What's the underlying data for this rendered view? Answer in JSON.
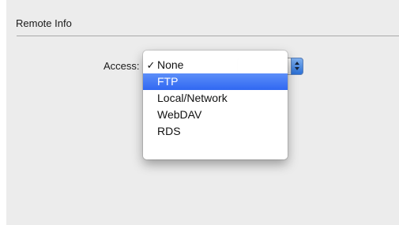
{
  "section": {
    "title": "Remote Info"
  },
  "access": {
    "label": "Access:",
    "selected": "None",
    "options": [
      {
        "label": "None",
        "checked": true,
        "highlighted": false
      },
      {
        "label": "FTP",
        "checked": false,
        "highlighted": true
      },
      {
        "label": "Local/Network",
        "checked": false,
        "highlighted": false
      },
      {
        "label": "WebDAV",
        "checked": false,
        "highlighted": false
      },
      {
        "label": "RDS",
        "checked": false,
        "highlighted": false
      }
    ],
    "check_glyph": "✓"
  },
  "colors": {
    "highlight": "#3c74f4",
    "panel": "#ececec"
  }
}
